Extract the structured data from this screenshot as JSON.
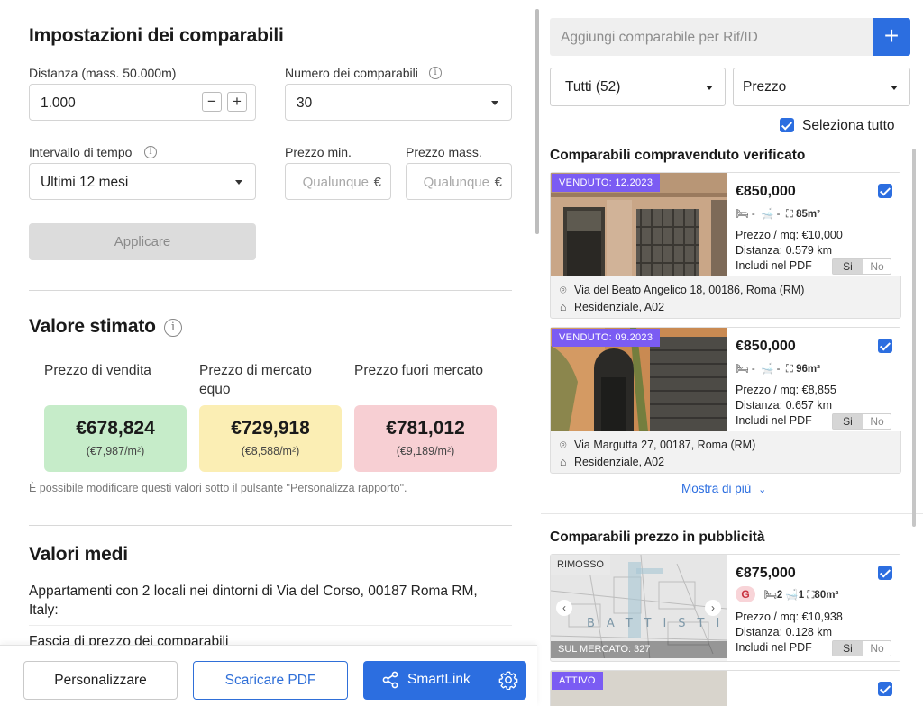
{
  "settings": {
    "title": "Impostazioni dei comparabili",
    "distance_label": "Distanza (mass. 50.000m)",
    "distance_value": "1.000",
    "count_label": "Numero dei comparabili",
    "count_value": "30",
    "time_label": "Intervallo di tempo",
    "time_value": "Ultimi 12 mesi",
    "min_price_label": "Prezzo min.",
    "max_price_label": "Prezzo mass.",
    "min_price_placeholder": "Qualunque",
    "max_price_placeholder": "Qualunque",
    "currency": "€",
    "apply_label": "Applicare"
  },
  "estimate": {
    "title": "Valore stimato",
    "columns": [
      {
        "label": "Prezzo di vendita",
        "value": "€678,824",
        "per_sqm": "(€7,987/m²)",
        "color": "#c6ecc9"
      },
      {
        "label": "Prezzo di mercato equo",
        "value": "€729,918",
        "per_sqm": "(€8,588/m²)",
        "color": "#fbeeb4"
      },
      {
        "label": "Prezzo fuori mercato",
        "value": "€781,012",
        "per_sqm": "(€9,189/m²)",
        "color": "#f7cfd3"
      }
    ],
    "note": "È possibile modificare questi valori sotto il pulsante \"Personalizza rapporto\"."
  },
  "averages": {
    "title": "Valori medi",
    "description": "Appartamenti con 2 locali nei dintorni di Via del Corso, 00187 Roma RM, Italy:",
    "range_label": "Fascia di prezzo dei comparabili"
  },
  "footer": {
    "customize_label": "Personalizzare",
    "pdf_label": "Scaricare PDF",
    "smartlink_label": "SmartLink"
  },
  "right": {
    "add_placeholder": "Aggiungi comparabile per Rif/ID",
    "filter_value": "Tutti (52)",
    "sort_value": "Prezzo",
    "select_all_label": "Seleziona tutto",
    "verified_title": "Comparabili compravenduto verificato",
    "ads_title": "Comparabili prezzo in pubblicità",
    "show_more": "Mostra di più",
    "include_pdf_label": "Includi nel PDF",
    "yes": "Si",
    "no": "No",
    "sold_cards": [
      {
        "badge": "VENDUTO: 12.2023",
        "price": "€850,000",
        "bed": "-",
        "bath": "-",
        "area": "85m²",
        "price_sqm": "Prezzo / mq: €10,000",
        "distance": "Distanza: 0.579 km",
        "address": "Via del Beato Angelico 18, 00186, Roma (RM)",
        "type": "Residenziale, A02"
      },
      {
        "badge": "VENDUTO: 09.2023",
        "price": "€850,000",
        "bed": "-",
        "bath": "-",
        "area": "96m²",
        "price_sqm": "Prezzo / mq: €8,855",
        "distance": "Distanza: 0.657 km",
        "address": "Via Margutta 27, 00187, Roma (RM)",
        "type": "Residenziale, A02"
      }
    ],
    "ad_card": {
      "status": "RIMOSSO",
      "market": "SUL MERCATO: 327",
      "map_text": "BATTISTI",
      "price": "€875,000",
      "energy": "G",
      "rooms": "2",
      "baths": "1",
      "area": "80m²",
      "price_sqm": "Prezzo / mq: €10,938",
      "distance": "Distanza: 0.128 km"
    },
    "next_badge": "ATTIVO"
  }
}
